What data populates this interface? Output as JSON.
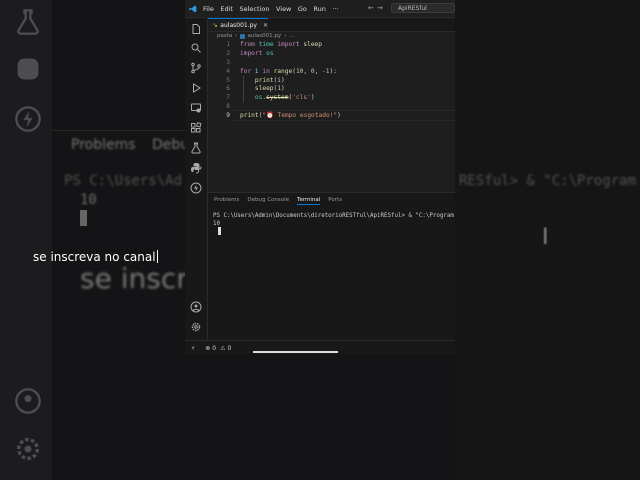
{
  "background_overlay": {
    "tabs": [
      "Problems",
      "Debug"
    ],
    "prompt_text": "PS C:\\Users\\Ad",
    "number": "10",
    "caption": "se inscre",
    "right_text": "RESful> & \"C:\\Program File"
  },
  "titlebar": {
    "menu": [
      "File",
      "Edit",
      "Selection",
      "View",
      "Go",
      "Run",
      "···"
    ],
    "search_text": "ApiRESful"
  },
  "editor": {
    "tab_label": "aulas001.py",
    "breadcrumb": [
      "pasta",
      "aulas001.py",
      "..."
    ],
    "lines": [
      {
        "n": "1",
        "tokens": [
          [
            "kw",
            "from"
          ],
          [
            "pl",
            " "
          ],
          [
            "mod",
            "time"
          ],
          [
            "pl",
            " "
          ],
          [
            "kw",
            "import"
          ],
          [
            "pl",
            " "
          ],
          [
            "fn",
            "sleep"
          ]
        ]
      },
      {
        "n": "2",
        "tokens": [
          [
            "kw",
            "import"
          ],
          [
            "pl",
            " "
          ],
          [
            "mod",
            "os"
          ]
        ]
      },
      {
        "n": "3",
        "tokens": []
      },
      {
        "n": "4",
        "tokens": [
          [
            "kw",
            "for"
          ],
          [
            "pl",
            " "
          ],
          [
            "id",
            "i"
          ],
          [
            "pl",
            " "
          ],
          [
            "kw",
            "in"
          ],
          [
            "pl",
            " "
          ],
          [
            "fn",
            "range"
          ],
          [
            "pl",
            "("
          ],
          [
            "num",
            "10"
          ],
          [
            "pl",
            ", "
          ],
          [
            "num",
            "0"
          ],
          [
            "pl",
            ", "
          ],
          [
            "num",
            "-1"
          ],
          [
            "pl",
            "):"
          ]
        ]
      },
      {
        "n": "5",
        "tokens": [
          [
            "pl",
            "    "
          ],
          [
            "fn",
            "print"
          ],
          [
            "pl",
            "("
          ],
          [
            "id",
            "i"
          ],
          [
            "pl",
            ")"
          ]
        ]
      },
      {
        "n": "6",
        "tokens": [
          [
            "pl",
            "    "
          ],
          [
            "fn",
            "sleep"
          ],
          [
            "pl",
            "("
          ],
          [
            "num",
            "1"
          ],
          [
            "pl",
            ")"
          ]
        ]
      },
      {
        "n": "7",
        "tokens": [
          [
            "pl",
            "    "
          ],
          [
            "mod",
            "os"
          ],
          [
            "pl",
            "."
          ],
          [
            "fn strike",
            "system"
          ],
          [
            "pl",
            "("
          ],
          [
            "str",
            "'cls'"
          ],
          [
            "pl",
            ")"
          ]
        ]
      },
      {
        "n": "8",
        "tokens": []
      },
      {
        "n": "9",
        "tokens": [
          [
            "fn",
            "print"
          ],
          [
            "pl",
            "("
          ],
          [
            "str",
            "\"⏰ Tempo esgotado!\""
          ],
          [
            "pl",
            ")"
          ]
        ]
      }
    ]
  },
  "panel": {
    "tabs": [
      "Problems",
      "Debug Console",
      "Terminal",
      "Ports"
    ],
    "active_tab": "Terminal",
    "terminal_lines": [
      "PS C:\\Users\\Admin\\Documents\\diretorioRESTful\\ApiRESful> & \"C:\\Program Fil",
      "10"
    ]
  },
  "caption": "se inscreva no canal",
  "statusbar": {
    "errors": "0",
    "warnings": "0"
  },
  "colors": {
    "accent": "#0078d4",
    "editor_bg": "#1e1e1e",
    "keyword": "#c586c0",
    "function": "#dcdcaa",
    "string": "#ce9178"
  }
}
